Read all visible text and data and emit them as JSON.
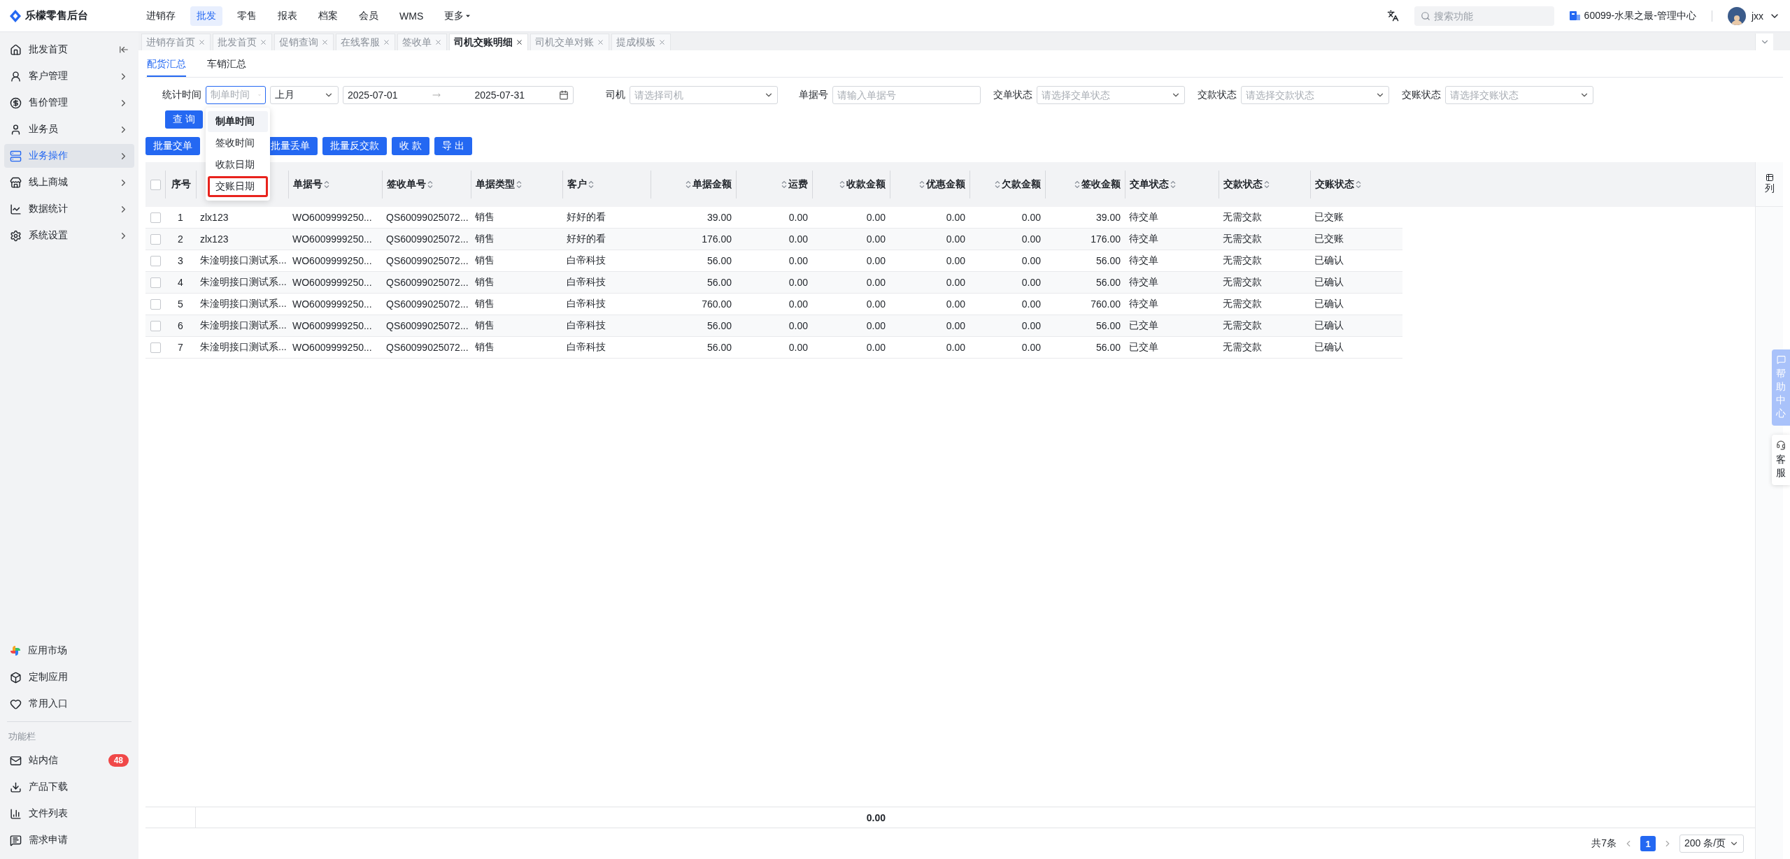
{
  "app": {
    "name": "乐檬零售后台"
  },
  "top_nav": [
    {
      "label": "进销存",
      "selected": false,
      "has_menu": false
    },
    {
      "label": "批发",
      "selected": true,
      "has_menu": false
    },
    {
      "label": "零售",
      "selected": false,
      "has_menu": false
    },
    {
      "label": "报表",
      "selected": false,
      "has_menu": false
    },
    {
      "label": "档案",
      "selected": false,
      "has_menu": false
    },
    {
      "label": "会员",
      "selected": false,
      "has_menu": false
    },
    {
      "label": "WMS",
      "selected": false,
      "has_menu": false
    },
    {
      "label": "更多",
      "selected": false,
      "has_menu": true
    }
  ],
  "header_right": {
    "search_placeholder": "搜索功能",
    "store": "60099-水果之最-管理中心",
    "user": "jxx"
  },
  "sidebar": {
    "items": [
      {
        "label": "批发首页",
        "selected": false,
        "kind": "collapse"
      },
      {
        "label": "客户管理",
        "selected": false,
        "kind": "submenu"
      },
      {
        "label": "售价管理",
        "selected": false,
        "kind": "submenu"
      },
      {
        "label": "业务员",
        "selected": false,
        "kind": "submenu"
      },
      {
        "label": "业务操作",
        "selected": true,
        "kind": "submenu"
      },
      {
        "label": "线上商城",
        "selected": false,
        "kind": "submenu"
      },
      {
        "label": "数据统计",
        "selected": false,
        "kind": "submenu"
      },
      {
        "label": "系统设置",
        "selected": false,
        "kind": "submenu"
      }
    ],
    "apps": [
      {
        "label": "应用市场"
      },
      {
        "label": "定制应用"
      },
      {
        "label": "常用入口"
      }
    ],
    "section_label": "功能栏",
    "tools": [
      {
        "label": "站内信",
        "badge": "48"
      },
      {
        "label": "产品下载"
      },
      {
        "label": "文件列表"
      },
      {
        "label": "需求申请"
      }
    ]
  },
  "tabs": [
    {
      "label": "进销存首页",
      "selected": false
    },
    {
      "label": "批发首页",
      "selected": false
    },
    {
      "label": "促销查询",
      "selected": false
    },
    {
      "label": "在线客服",
      "selected": false
    },
    {
      "label": "签收单",
      "selected": false
    },
    {
      "label": "司机交账明细",
      "selected": true
    },
    {
      "label": "司机交单对账",
      "selected": false
    },
    {
      "label": "提成模板",
      "selected": false
    }
  ],
  "sub_tabs": [
    {
      "label": "配货汇总",
      "selected": true
    },
    {
      "label": "车销汇总",
      "selected": false
    }
  ],
  "filters": {
    "time_label": "统计时间",
    "time_type": {
      "value": "制单时间",
      "open": true
    },
    "period": "上月",
    "date_from": "2025-07-01",
    "date_to": "2025-07-31",
    "fields": [
      {
        "label": "司机",
        "placeholder": "请选择司机",
        "kind": "select"
      },
      {
        "label": "单据号",
        "placeholder": "请输入单据号",
        "kind": "input"
      },
      {
        "label": "交单状态",
        "placeholder": "请选择交单状态",
        "kind": "select"
      },
      {
        "label": "交款状态",
        "placeholder": "请选择交款状态",
        "kind": "select"
      },
      {
        "label": "交账状态",
        "placeholder": "请选择交账状态",
        "kind": "select"
      }
    ]
  },
  "time_type_options": [
    {
      "label": "制单时间",
      "selected": true,
      "highlighted": false
    },
    {
      "label": "签收时间",
      "selected": false,
      "highlighted": false
    },
    {
      "label": "收款日期",
      "selected": false,
      "highlighted": false
    },
    {
      "label": "交账日期",
      "selected": false,
      "highlighted": true
    }
  ],
  "query_button": "查 询",
  "actions": [
    "批量交单",
    "批量丢单",
    "批量反交款",
    "收 款",
    "导 出"
  ],
  "table": {
    "select_all": {
      "checked": false
    },
    "columns": [
      {
        "label": "序号",
        "sortable": false
      },
      {
        "sortable": false
      },
      {
        "label": "单据号",
        "sortable": true
      },
      {
        "label": "签收单号",
        "sortable": true
      },
      {
        "label": "单据类型",
        "sortable": true
      },
      {
        "label": "客户",
        "sortable": true
      },
      {
        "label": "单据金额",
        "sortable": true
      },
      {
        "label": "运费",
        "sortable": true
      },
      {
        "label": "收款金额",
        "sortable": true
      },
      {
        "label": "优惠金额",
        "sortable": true
      },
      {
        "label": "欠款金额",
        "sortable": true
      },
      {
        "label": "签收金额",
        "sortable": true
      },
      {
        "label": "交单状态",
        "sortable": true
      },
      {
        "label": "交款状态",
        "sortable": true
      },
      {
        "label": "交账状态",
        "sortable": true
      }
    ],
    "rows": [
      {
        "checked": false,
        "cells": [
          "1",
          "zlx123",
          "WO6009999250...",
          "QS60099025072...",
          "销售",
          "好好的看",
          "39.00",
          "0.00",
          "0.00",
          "0.00",
          "0.00",
          "39.00",
          "待交单",
          "无需交款",
          "已交账"
        ]
      },
      {
        "checked": false,
        "cells": [
          "2",
          "zlx123",
          "WO6009999250...",
          "QS60099025072...",
          "销售",
          "好好的看",
          "176.00",
          "0.00",
          "0.00",
          "0.00",
          "0.00",
          "176.00",
          "待交单",
          "无需交款",
          "已交账"
        ]
      },
      {
        "checked": false,
        "cells": [
          "3",
          "朱淦明接口测试系...",
          "WO6009999250...",
          "QS60099025072...",
          "销售",
          "白帝科技",
          "56.00",
          "0.00",
          "0.00",
          "0.00",
          "0.00",
          "56.00",
          "待交单",
          "无需交款",
          "已确认"
        ]
      },
      {
        "checked": false,
        "cells": [
          "4",
          "朱淦明接口测试系...",
          "WO6009999250...",
          "QS60099025072...",
          "销售",
          "白帝科技",
          "56.00",
          "0.00",
          "0.00",
          "0.00",
          "0.00",
          "56.00",
          "待交单",
          "无需交款",
          "已确认"
        ]
      },
      {
        "checked": false,
        "cells": [
          "5",
          "朱淦明接口测试系...",
          "WO6009999250...",
          "QS60099025072...",
          "销售",
          "白帝科技",
          "760.00",
          "0.00",
          "0.00",
          "0.00",
          "0.00",
          "760.00",
          "待交单",
          "无需交款",
          "已确认"
        ]
      },
      {
        "checked": false,
        "cells": [
          "6",
          "朱淦明接口测试系...",
          "WO6009999250...",
          "QS60099025072...",
          "销售",
          "白帝科技",
          "56.00",
          "0.00",
          "0.00",
          "0.00",
          "0.00",
          "56.00",
          "已交单",
          "无需交款",
          "已确认"
        ]
      },
      {
        "checked": false,
        "cells": [
          "7",
          "朱淦明接口测试系...",
          "WO6009999250...",
          "QS60099025072...",
          "销售",
          "白帝科技",
          "56.00",
          "0.00",
          "0.00",
          "0.00",
          "0.00",
          "56.00",
          "已交单",
          "无需交款",
          "已确认"
        ]
      }
    ],
    "summary_total": "0.00",
    "column_settings": "列"
  },
  "pagination": {
    "total": "共7条",
    "pages": [
      {
        "label": "1",
        "selected": true
      }
    ],
    "page_size": "200 条/页"
  },
  "side_float": {
    "help": "帮助中心",
    "service": "客服"
  }
}
